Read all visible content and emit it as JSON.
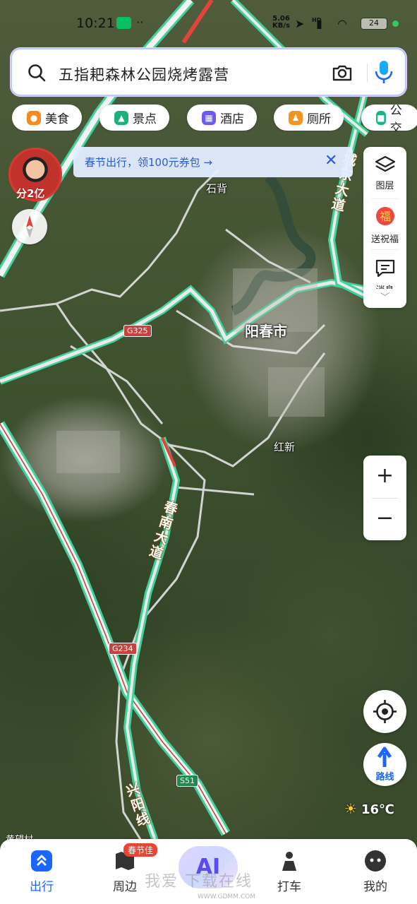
{
  "status_bar": {
    "time": "10:21",
    "net_speed_value": "5.06",
    "net_speed_unit": "KB/s",
    "hd": "HD",
    "battery": "24",
    "dots": "··"
  },
  "search": {
    "query": "五指耙森林公园烧烤露营"
  },
  "chips": [
    {
      "label": "美食",
      "color": "#f58b1f",
      "icon": "food-icon"
    },
    {
      "label": "景点",
      "color": "#19b37a",
      "icon": "scenic-icon"
    },
    {
      "label": "酒店",
      "color": "#6a5cf0",
      "icon": "hotel-icon"
    },
    {
      "label": "厕所",
      "color": "#f2941f",
      "icon": "toilet-icon"
    },
    {
      "label": "公交",
      "color": "#19b38a",
      "icon": "bus-icon"
    }
  ],
  "avatar": {
    "badge": "分2亿"
  },
  "promo": {
    "text": "春节出行，领100元券包 →"
  },
  "tools": {
    "layers": "图层",
    "blessing": "送祝福",
    "message": "消息"
  },
  "map": {
    "city": "阳春市",
    "town_shibei": "石背",
    "town_hongxin": "红新",
    "road_chengdong": "城东大道",
    "road_chunnan": "春南大道",
    "road_xingyang": "兴阳线",
    "shield_g325": "G325",
    "shield_g234": "G234",
    "shield_s51": "S51",
    "corner_text": "黄望村"
  },
  "weather": {
    "temp": "16℃"
  },
  "bottom_nav": {
    "items": [
      {
        "label": "出行",
        "active": true
      },
      {
        "label": "周边",
        "active": false
      },
      {
        "label": "AI",
        "active": false
      },
      {
        "label": "打车",
        "active": false
      },
      {
        "label": "我的",
        "active": false
      }
    ],
    "zhoubian_badge": "春节佳"
  },
  "watermark": {
    "text": "我爱 下载在线",
    "sub": "WWW.GDMM.COM"
  },
  "colors": {
    "accent": "#1a66ff",
    "road_green": "#3fd29a",
    "road_white": "#e6e6e6",
    "road_red": "#e2433a"
  }
}
